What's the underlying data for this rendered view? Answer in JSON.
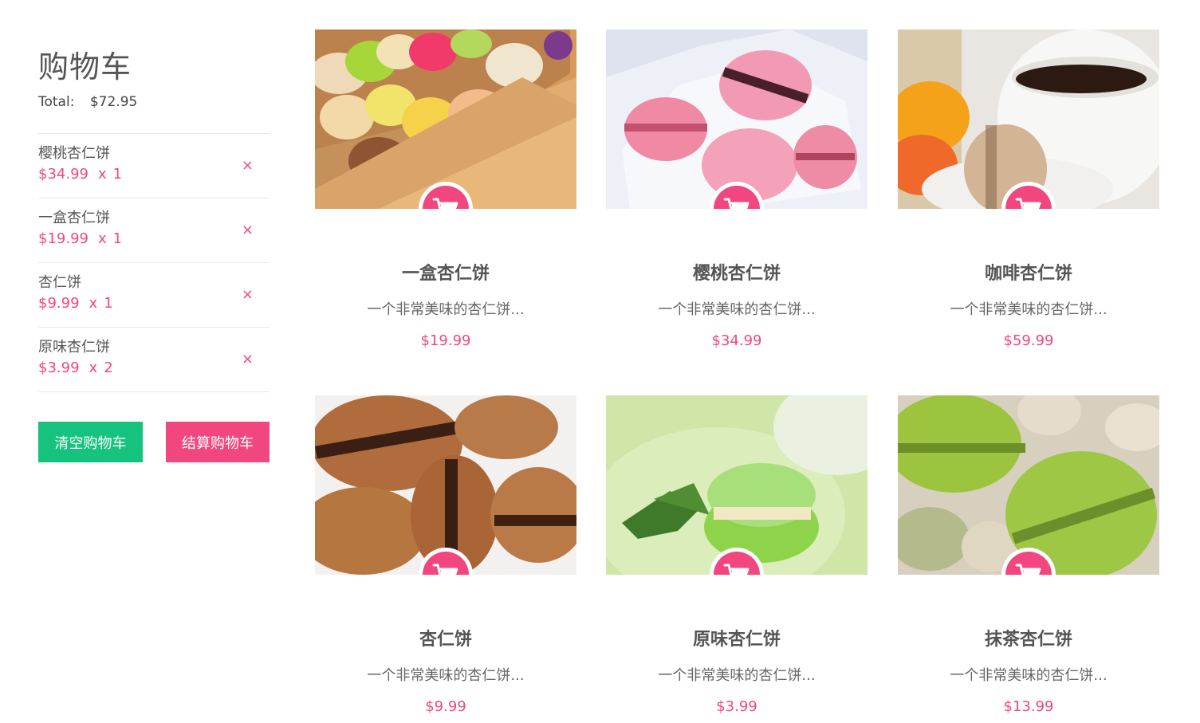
{
  "cart": {
    "title": "购物车",
    "total_label": "Total:",
    "total_value": "$72.95",
    "items": [
      {
        "name": "樱桃杏仁饼",
        "price": "$34.99",
        "times": "x",
        "qty": "1",
        "remove": "×"
      },
      {
        "name": "一盒杏仁饼",
        "price": "$19.99",
        "times": "x",
        "qty": "1",
        "remove": "×"
      },
      {
        "name": "杏仁饼",
        "price": "$9.99",
        "times": "x",
        "qty": "1",
        "remove": "×"
      },
      {
        "name": "原味杏仁饼",
        "price": "$3.99",
        "times": "x",
        "qty": "2",
        "remove": "×"
      }
    ],
    "clear_label": "清空购物车",
    "checkout_label": "结算购物车"
  },
  "products": [
    {
      "name": "一盒杏仁饼",
      "desc": "一个非常美味的杏仁饼...",
      "price": "$19.99"
    },
    {
      "name": "樱桃杏仁饼",
      "desc": "一个非常美味的杏仁饼...",
      "price": "$34.99"
    },
    {
      "name": "咖啡杏仁饼",
      "desc": "一个非常美味的杏仁饼...",
      "price": "$59.99"
    },
    {
      "name": "杏仁饼",
      "desc": "一个非常美味的杏仁饼...",
      "price": "$9.99"
    },
    {
      "name": "原味杏仁饼",
      "desc": "一个非常美味的杏仁饼...",
      "price": "$3.99"
    },
    {
      "name": "抹茶杏仁饼",
      "desc": "一个非常美味的杏仁饼...",
      "price": "$13.99"
    }
  ],
  "colors": {
    "accent": "#f2467f",
    "clear_button": "#15c27e"
  },
  "icons": {
    "add_to_cart": "shopping-cart-icon",
    "remove": "close-icon"
  }
}
